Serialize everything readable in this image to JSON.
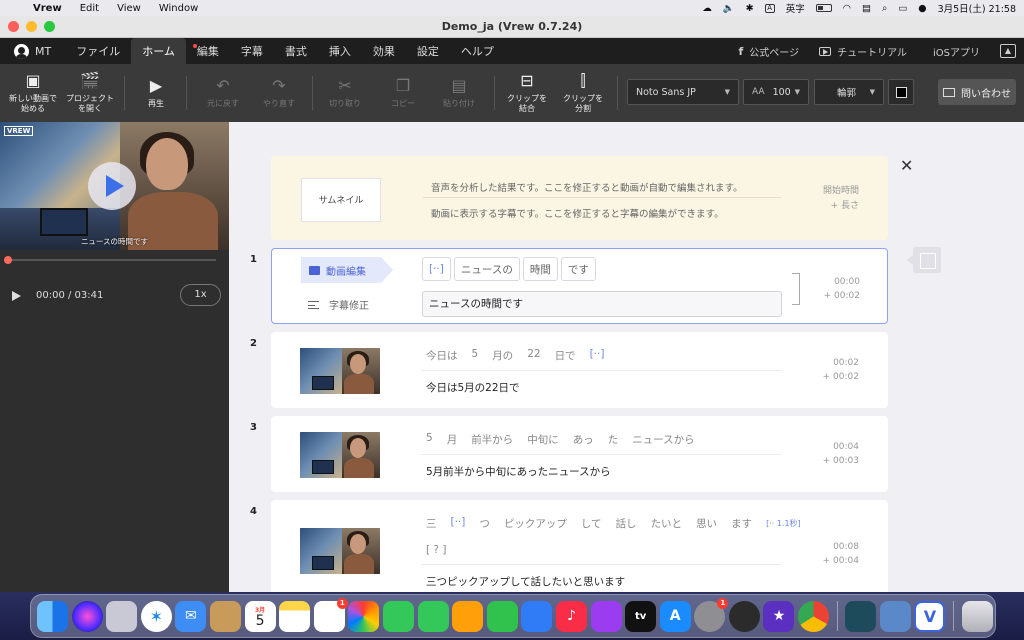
{
  "menubar": {
    "app_name": "Vrew",
    "items": [
      "Edit",
      "View",
      "Window"
    ],
    "input_indicator": "A",
    "input_label": "英字",
    "datetime": "3月5日(土) 21:58"
  },
  "window": {
    "title": "Demo_ja (Vrew 0.7.24)"
  },
  "app_tabs": {
    "user": "MT",
    "tabs": [
      "ファイル",
      "ホーム",
      "編集",
      "字幕",
      "書式",
      "挿入",
      "効果",
      "設定",
      "ヘルプ"
    ],
    "active_tab": "ホーム",
    "links": {
      "official": "公式ページ",
      "tutorial": "チュートリアル",
      "ios": "iOSアプリ"
    }
  },
  "toolbar": {
    "new_video": "新しい動画で\n始める",
    "open_project": "プロジェクト\nを開く",
    "play": "再生",
    "undo": "元に戻す",
    "redo": "やり直す",
    "cut": "切り取り",
    "copy": "コピー",
    "paste": "貼り付け",
    "merge_clips": "クリップを\n結合",
    "split_clips": "クリップを\n分割",
    "font": "Noto Sans JP",
    "font_size": "100",
    "outline": "輪郭",
    "outline_color": "#000000",
    "contact": "問い合わせ"
  },
  "preview": {
    "logo": "VREW",
    "caption": "ニュースの時間です",
    "timecode": "00:00 / 03:41",
    "speed": "1x",
    "progress": 0
  },
  "header": {
    "thumbnail_label": "サムネイル",
    "line1": "音声を分析した結果です。ここを修正すると動画が自動で編集されます。",
    "line2": "動画に表示する字幕です。ここを修正すると字幕の編集ができます。",
    "meta_start": "開始時間",
    "meta_length": "+ 長さ"
  },
  "clips": [
    {
      "num": "1",
      "edit_label": "動画編集",
      "subfix_label": "字幕修正",
      "words": [
        "[··]",
        "ニュースの",
        "時間",
        "です"
      ],
      "subtitle": "ニュースの時間です",
      "start": "00:00",
      "length": "+ 00:02"
    },
    {
      "num": "2",
      "words": [
        "今日は",
        "5",
        "月の",
        "22",
        "日で",
        "[··]"
      ],
      "subtitle": "今日は5月の22日で",
      "start": "00:02",
      "length": "+ 00:02"
    },
    {
      "num": "3",
      "words": [
        "5",
        "月",
        "前半から",
        "中旬に",
        "あっ",
        "た",
        "ニュースから"
      ],
      "subtitle": "5月前半から中旬にあったニュースから",
      "start": "00:04",
      "length": "+ 00:03"
    },
    {
      "num": "4",
      "words": [
        "三",
        "[··]",
        "つ",
        "ピックアップ",
        "して",
        "話し",
        "たいと",
        "思い",
        "ます",
        "[·· 1.1秒]"
      ],
      "words2": [
        "[ ? ]"
      ],
      "subtitle": "三つピックアップして話したいと思います",
      "start": "00:08",
      "length": "+ 00:04"
    }
  ],
  "dock": {
    "calendar_month": "3月",
    "calendar_day": "5",
    "reminders_badge": "1",
    "settings_badge": "1",
    "tv_label": "tv"
  }
}
